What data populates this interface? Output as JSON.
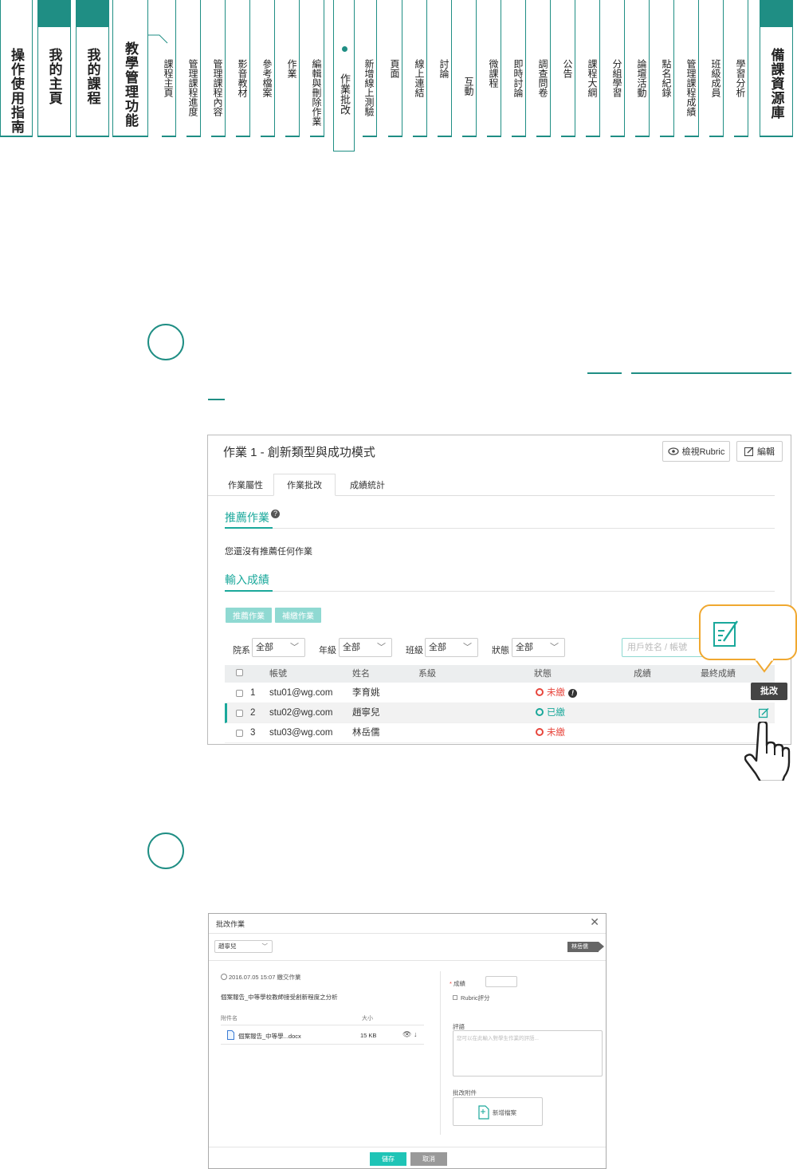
{
  "top_nav": {
    "main_tabs": [
      {
        "label": "操作使用指南"
      },
      {
        "label": "我的主頁"
      },
      {
        "label": "我的課程"
      },
      {
        "label": "教學管理功能"
      }
    ],
    "sub_tabs": [
      {
        "label": "課程主頁"
      },
      {
        "label": "管理課程進度"
      },
      {
        "label": "管理課程內容"
      },
      {
        "label": "影音教材"
      },
      {
        "label": "參考檔案"
      },
      {
        "label": "作業"
      },
      {
        "label": "編輯與刪除作業"
      },
      {
        "label": "作業批改"
      },
      {
        "label": "新增線上測驗"
      },
      {
        "label": "頁面"
      },
      {
        "label": "線上連結"
      },
      {
        "label": "討論"
      },
      {
        "label": "互動"
      },
      {
        "label": "微課程"
      },
      {
        "label": "即時討論"
      },
      {
        "label": "調查問卷"
      },
      {
        "label": "公告"
      },
      {
        "label": "課程大綱"
      },
      {
        "label": "分組學習"
      },
      {
        "label": "論壇活動"
      },
      {
        "label": "點名紀錄"
      },
      {
        "label": "管理課程成績"
      },
      {
        "label": "班級成員"
      },
      {
        "label": "學習分析"
      }
    ],
    "right_tab": {
      "label": "備課資源庫"
    },
    "active_sub_tab": "作業批改",
    "accent_color": "#1f8e84"
  },
  "assignment_page": {
    "title": "作業 1 - 創新類型與成功模式",
    "view_rubric_label": "檢視Rubric",
    "edit_label": "編輯",
    "tabs": [
      "作業屬性",
      "作業批改",
      "成績統計"
    ],
    "recommended_title": "推薦作業",
    "recommended_empty": "您還沒有推薦任何作業",
    "grades_title": "輸入成績",
    "recommend_btn": "推薦作業",
    "resubmit_btn": "補繳作業",
    "filters": [
      {
        "label": "院系",
        "value": "全部"
      },
      {
        "label": "年級",
        "value": "全部"
      },
      {
        "label": "班級",
        "value": "全部"
      },
      {
        "label": "狀態",
        "value": "全部"
      }
    ],
    "search_placeholder": "用戶姓名 / 帳號",
    "columns": [
      "帳號",
      "姓名",
      "系級",
      "狀態",
      "成績",
      "最終成績"
    ],
    "rows": [
      {
        "no": "1",
        "account": "stu01@wg.com",
        "name": "李育姚",
        "status": "未繳"
      },
      {
        "no": "2",
        "account": "stu02@wg.com",
        "name": "趙寧兒",
        "status": "已繳"
      },
      {
        "no": "3",
        "account": "stu03@wg.com",
        "name": "林岳儒",
        "status": "未繳"
      }
    ],
    "tooltip": "批改",
    "accent_color": "#1aa89b",
    "unsubmitted_color": "#e8463d"
  },
  "grading_dialog": {
    "title": "批改作業",
    "student_select": "趙寧兒",
    "next_student": "林岳儒",
    "submitted_at": "2016.07.05 15:07 繳交作業",
    "assignment_desc": "個案報告_中等學校教師接受創新程度之分析",
    "attach_header": "附件名",
    "size_header": "大小",
    "file_name": "個案報告_中等學...docx",
    "file_size": "15 KB",
    "grade_label": "成績",
    "rubric_label": "Rubric評分",
    "comment_label": "評語",
    "comment_placeholder": "您可以在此輸入對學生作業的評語...",
    "attach_label": "批改附件",
    "add_file_label": "新增檔案",
    "save_label": "儲存",
    "cancel_label": "取消"
  }
}
